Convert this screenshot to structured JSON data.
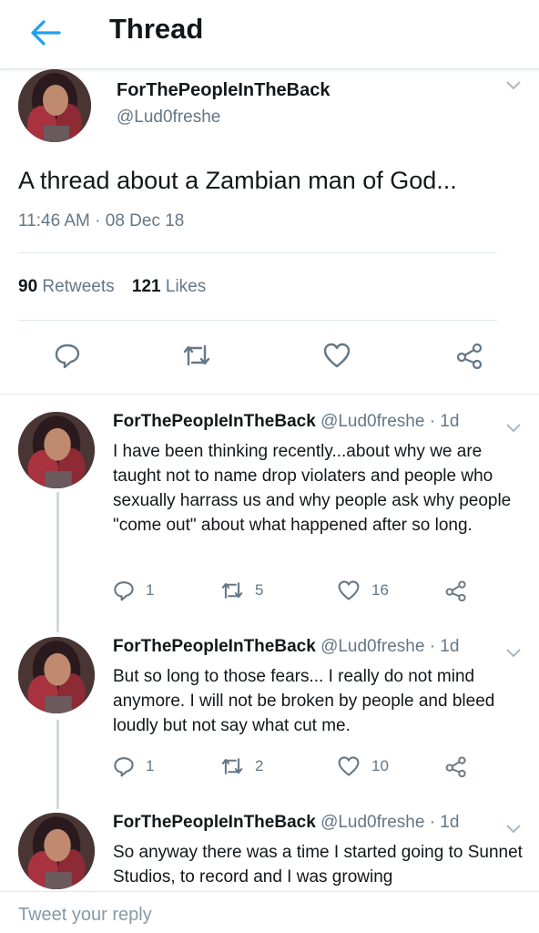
{
  "header": {
    "title": "Thread"
  },
  "main_tweet": {
    "name": "ForThePeopleInTheBack",
    "handle": "@Lud0freshe",
    "text": "A thread about a Zambian man of God...",
    "timestamp": "11:46 AM · 08 Dec 18",
    "retweets_count": "90",
    "retweets_label": "Retweets",
    "likes_count": "121",
    "likes_label": "Likes"
  },
  "replies": [
    {
      "name": "ForThePeopleInTheBack",
      "handle_time": "@Lud0freshe · 1d",
      "text": "I have been thinking recently...about why we are taught not to name drop violaters and people who sexually harrass us and why people ask why people \"come out\" about what happened after so long.",
      "replies": "1",
      "retweets": "5",
      "likes": "16"
    },
    {
      "name": "ForThePeopleInTheBack",
      "handle_time": "@Lud0freshe · 1d",
      "text": "But so long to those fears... I really do not mind anymore. I will not be broken by people and bleed loudly but not say what cut me.",
      "replies": "1",
      "retweets": "2",
      "likes": "10"
    },
    {
      "name": "ForThePeopleInTheBack",
      "handle_time": "@Lud0freshe · 1d",
      "text": "So anyway there was a time I started going to Sunnet Studios, to record and I was growing"
    }
  ],
  "footer": {
    "reply_placeholder": "Tweet your reply"
  },
  "colors": {
    "accent": "#1da1f2",
    "muted": "#657786",
    "divider": "#e1e8ed"
  }
}
